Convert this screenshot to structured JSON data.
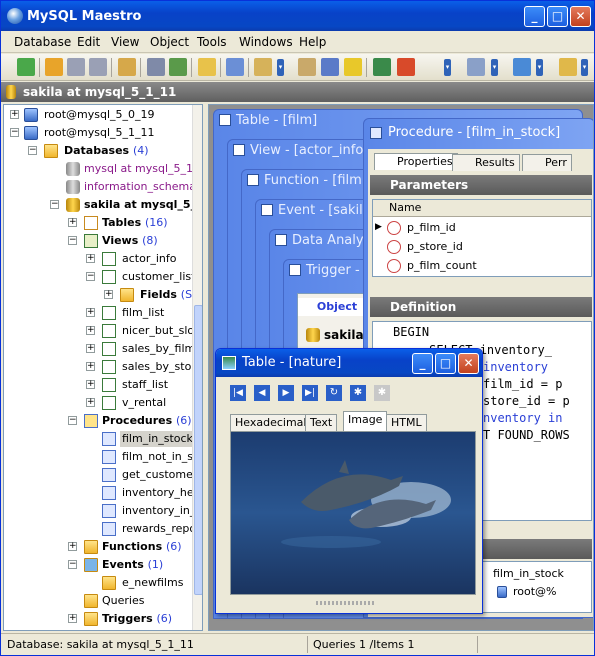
{
  "window": {
    "title": "MySQL Maestro"
  },
  "menu": [
    "Database",
    "Edit",
    "View",
    "Object",
    "Tools",
    "Windows",
    "Help"
  ],
  "db_bar": {
    "label": "sakila at mysql_5_1_11"
  },
  "tree": {
    "servers": [
      "root@mysql_5_0_19",
      "root@mysql_5_1_11"
    ],
    "databases_label": "Databases",
    "databases_count": "(4)",
    "db_items": [
      "mysql at mysql_5_1_1",
      "information_schema a"
    ],
    "current_db": "sakila at mysql_5_",
    "tables_label": "Tables",
    "tables_count": "(16)",
    "views_label": "Views",
    "views_count": "(8)",
    "views": [
      "actor_info",
      "customer_list",
      "film_list",
      "nicer_but_slo",
      "sales_by_film_",
      "sales_by_stor",
      "staff_list",
      "v_rental"
    ],
    "fields_label": "Fields",
    "fields_count": "(S",
    "procedures_label": "Procedures",
    "procedures_count": "(6)",
    "procedures": [
      "film_in_stock",
      "film_not_in_st",
      "get_customer",
      "inventory_hel",
      "inventory_in_",
      "rewards_repo"
    ],
    "functions_label": "Functions",
    "functions_count": "(6)",
    "events_label": "Events",
    "events_count": "(1)",
    "events": [
      "e_newfilms"
    ],
    "queries_label": "Queries",
    "triggers_label": "Triggers",
    "triggers_count": "(6)"
  },
  "mdi": {
    "windows": [
      "Table - [film]",
      "View - [actor_info",
      "Function - [film",
      "Event - [sakil",
      "Data Analys",
      "Trigger -"
    ],
    "object_tab": "Object",
    "object_item": "sakila"
  },
  "procedure": {
    "title": "Procedure - [film_in_stock]",
    "tabs": [
      "Properties",
      "Results",
      "Perr"
    ],
    "parameters_label": "Parameters",
    "name_header": "Name",
    "params": [
      "p_film_id",
      "p_store_id",
      "p_film_count"
    ],
    "definition_label": "Definition",
    "code": [
      "BEGIN",
      "     SELECT inventory_",
      "inventory",
      "film_id = p",
      "store_id = p",
      "nventory in",
      "T FOUND_ROWS"
    ],
    "lower_col": "film_in_stock",
    "lower_value": "root@%"
  },
  "nature": {
    "title": "Table - [nature]",
    "tabs": [
      "Hexadecimal",
      "Text",
      "Image",
      "HTML"
    ]
  },
  "status": {
    "database": "Database: sakila at mysql_5_1_11",
    "queries": "Queries 1 /Items 1"
  }
}
